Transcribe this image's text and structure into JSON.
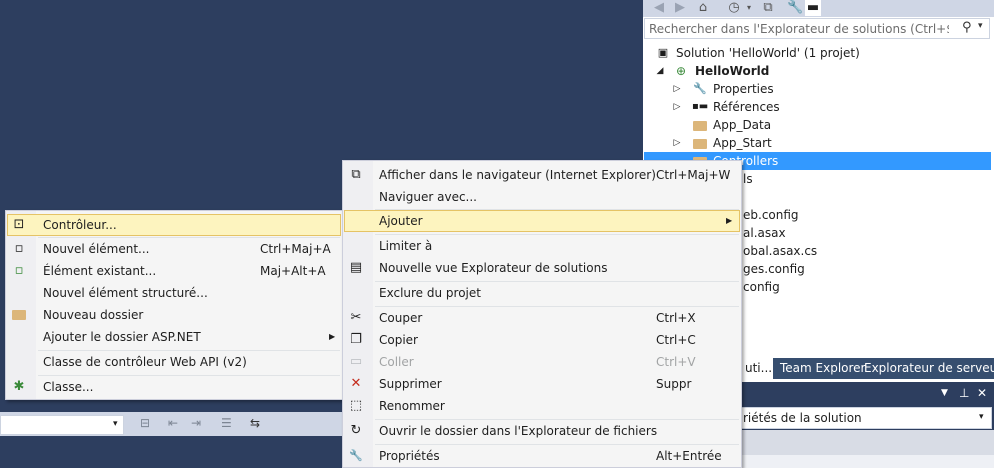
{
  "solution_explorer": {
    "search_placeholder": "Rechercher dans l'Explorateur de solutions (Ctrl+$)",
    "tree": [
      {
        "label": "Solution 'HelloWorld' (1 projet)",
        "icon": "solution-icon"
      },
      {
        "label": "HelloWorld",
        "icon": "web-project-icon"
      },
      {
        "label": "Properties",
        "icon": "wrench-icon"
      },
      {
        "label": "Références",
        "icon": "references-icon"
      },
      {
        "label": "App_Data",
        "icon": "folder-icon"
      },
      {
        "label": "App_Start",
        "icon": "folder-icon"
      },
      {
        "label": "Controllers",
        "icon": "folder-icon"
      },
      {
        "label": "ls"
      },
      {
        "label": "eb.config"
      },
      {
        "label": "al.asax"
      },
      {
        "label": "obal.asax.cs"
      },
      {
        "label": "ges.config"
      },
      {
        "label": "config"
      }
    ],
    "tabs": [
      "uti...",
      "Team Explorer",
      "Explorateur de serveurs"
    ]
  },
  "properties": {
    "combo_value": "riétés de la solution"
  },
  "left_menu": {
    "items": [
      {
        "label": "Contrôleur...",
        "shortcut": "",
        "icon": "controller-icon"
      },
      {
        "label": "Nouvel élément...",
        "shortcut": "Ctrl+Maj+A",
        "icon": "new-item-icon"
      },
      {
        "label": "Élément existant...",
        "shortcut": "Maj+Alt+A",
        "icon": "existing-item-icon"
      },
      {
        "label": "Nouvel élément structuré...",
        "shortcut": "",
        "icon": ""
      },
      {
        "label": "Nouveau dossier",
        "shortcut": "",
        "icon": "new-folder-icon"
      },
      {
        "label": "Ajouter le dossier ASP.NET",
        "shortcut": "",
        "icon": ""
      },
      {
        "label": "Classe de contrôleur Web API (v2)",
        "shortcut": "",
        "icon": ""
      },
      {
        "label": "Classe...",
        "shortcut": "",
        "icon": "class-icon"
      }
    ]
  },
  "main_menu": {
    "items": [
      {
        "label": "Afficher dans le navigateur (Internet Explorer)",
        "shortcut": "Ctrl+Maj+W",
        "icon": "browser-icon"
      },
      {
        "label": "Naviguer avec...",
        "shortcut": "",
        "icon": ""
      },
      {
        "label": "Ajouter",
        "shortcut": "",
        "icon": ""
      },
      {
        "label": "Limiter à",
        "shortcut": "",
        "icon": ""
      },
      {
        "label": "Nouvelle vue Explorateur de solutions",
        "shortcut": "",
        "icon": "new-view-icon"
      },
      {
        "label": "Exclure du projet",
        "shortcut": "",
        "icon": ""
      },
      {
        "label": "Couper",
        "shortcut": "Ctrl+X",
        "icon": "scissors-icon"
      },
      {
        "label": "Copier",
        "shortcut": "Ctrl+C",
        "icon": "copy-icon"
      },
      {
        "label": "Coller",
        "shortcut": "Ctrl+V",
        "icon": "paste-icon"
      },
      {
        "label": "Supprimer",
        "shortcut": "Suppr",
        "icon": "delete-icon"
      },
      {
        "label": "Renommer",
        "shortcut": "",
        "icon": "rename-icon"
      },
      {
        "label": "Ouvrir le dossier dans l'Explorateur de fichiers",
        "shortcut": "",
        "icon": "refresh-icon"
      },
      {
        "label": "Propriétés",
        "shortcut": "Alt+Entrée",
        "icon": "wrench-icon"
      }
    ]
  },
  "colors": {
    "background": "#2d3e5f",
    "selection": "#3399ff",
    "menu_highlight": "#fdf4bf"
  }
}
